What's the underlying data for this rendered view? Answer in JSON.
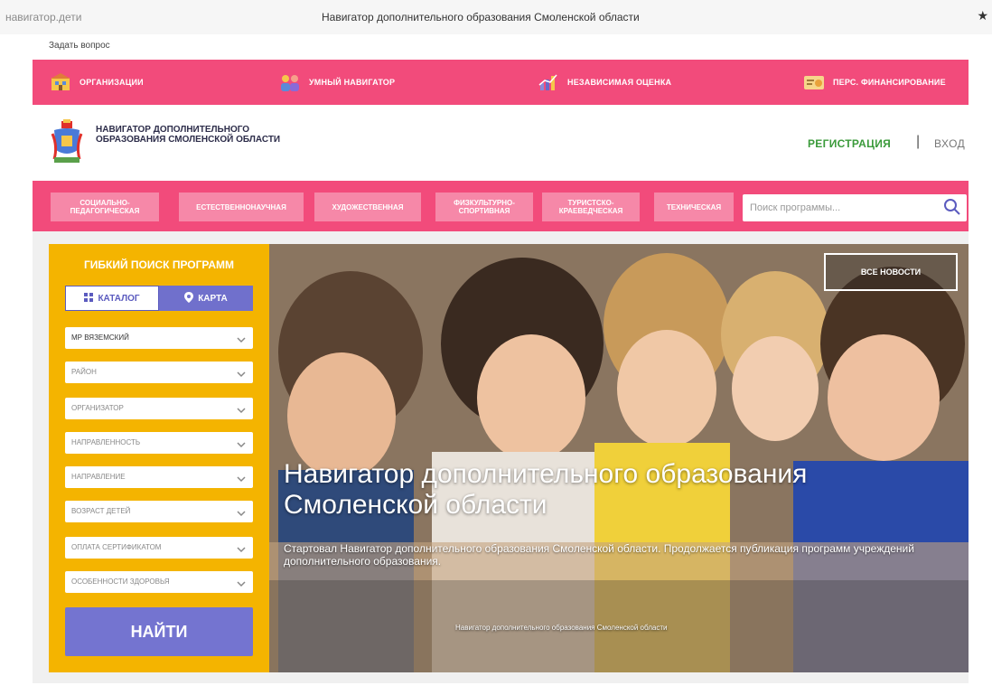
{
  "browser": {
    "url": "навигатор.дети",
    "title": "Навигатор дополнительного образования Смоленской области",
    "star": "★"
  },
  "ask": "Задать вопрос",
  "top_nav": [
    {
      "label": "ОРГАНИЗАЦИИ",
      "icon": "building-icon"
    },
    {
      "label": "УМНЫЙ НАВИГАТОР",
      "icon": "people-icon"
    },
    {
      "label": "НЕЗАВИСИМАЯ ОЦЕНКА",
      "icon": "chart-icon"
    },
    {
      "label": "ПЕРС. ФИНАНСИРОВАНИЕ",
      "icon": "certificate-icon"
    }
  ],
  "header": {
    "logo_text": "НАВИГАТОР ДОПОЛНИТЕЛЬНОГО ОБРАЗОВАНИЯ СМОЛЕНСКОЙ ОБЛАСТИ",
    "register": "РЕГИСТРАЦИЯ",
    "separator": "|",
    "login": "ВХОД"
  },
  "categories": [
    "СОЦИАЛЬНО-ПЕДАГОГИЧЕСКАЯ",
    "ЕСТЕСТВЕННОНАУЧНАЯ",
    "ХУДОЖЕСТВЕННАЯ",
    "ФИЗКУЛЬТУРНО-СПОРТИВНАЯ",
    "ТУРИСТСКО-КРАЕВЕДЧЕСКАЯ",
    "ТЕХНИЧЕСКАЯ"
  ],
  "search": {
    "placeholder": "Поиск программы..."
  },
  "panel": {
    "title": "ГИБКИЙ ПОИСК ПРОГРАММ",
    "catalog": "КАТАЛОГ",
    "map": "КАРТА",
    "selects": [
      "МР ВЯЗЕМСКИЙ",
      "РАЙОН",
      "ОРГАНИЗАТОР",
      "НАПРАВЛЕННОСТЬ",
      "НАПРАВЛЕНИЕ",
      "ВОЗРАСТ ДЕТЕЙ",
      "ОПЛАТА СЕРТИФИКАТОМ",
      "ОСОБЕННОСТИ ЗДОРОВЬЯ"
    ],
    "find": "НАЙТИ"
  },
  "hero": {
    "all_news": "ВСЕ НОВОСТИ",
    "title": "Навигатор дополнительного образования Смоленской области",
    "text": "Стартовал Навигатор дополнительного образования Смоленской области. Продолжается публикация программ учреждений дополнительного образования.",
    "caption": "Навигатор дополнительного образования Смоленской области"
  },
  "colors": {
    "pink": "#f24b7b",
    "yellow": "#f4b400",
    "purple": "#7474d0",
    "green": "#3a9a3a"
  }
}
